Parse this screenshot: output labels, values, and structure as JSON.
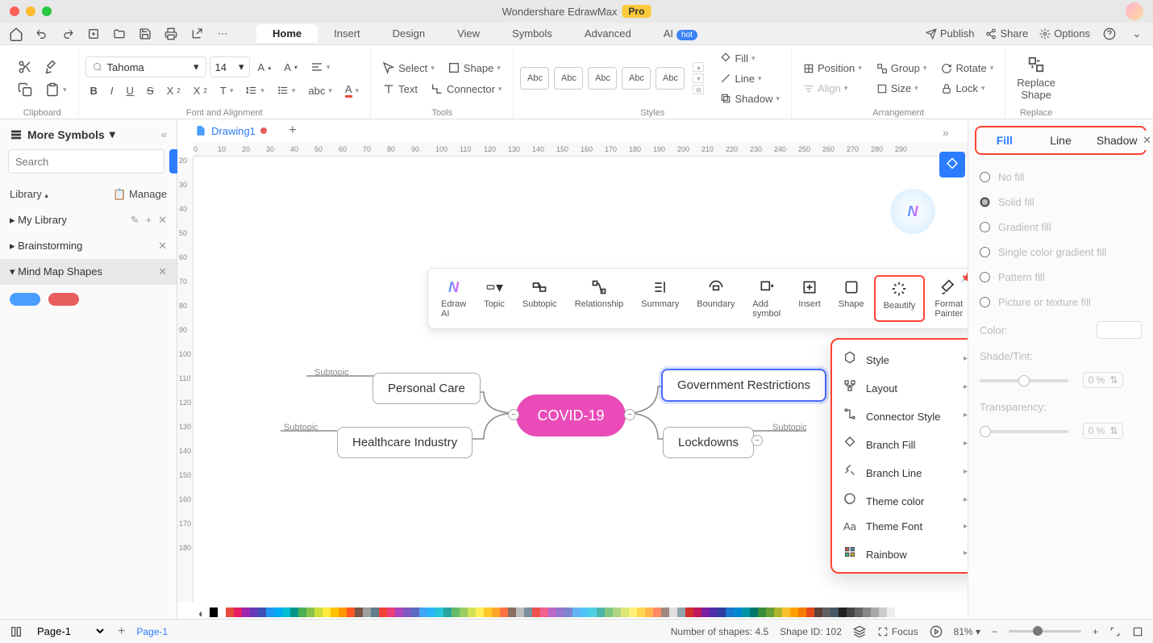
{
  "title": {
    "app": "Wondershare EdrawMax",
    "badge": "Pro"
  },
  "mainTabs": [
    "Home",
    "Insert",
    "Design",
    "View",
    "Symbols",
    "Advanced"
  ],
  "aiTab": {
    "label": "AI",
    "badge": "hot"
  },
  "toolbarActions": {
    "publish": "Publish",
    "share": "Share",
    "options": "Options"
  },
  "ribbon": {
    "clipboard": "Clipboard",
    "fontAlign": "Font and Alignment",
    "tools": "Tools",
    "styles": "Styles",
    "arrangement": "Arrangement",
    "replace": "Replace",
    "font": {
      "name": "Tahoma",
      "size": "14"
    },
    "select": "Select",
    "shape": "Shape",
    "text": "Text",
    "connector": "Connector",
    "styleSample": "Abc",
    "fill": "Fill",
    "line": "Line",
    "shadow": "Shadow",
    "position": "Position",
    "align": "Align",
    "group": "Group",
    "sizeBtn": "Size",
    "rotate": "Rotate",
    "lock": "Lock",
    "replaceShape": "Replace\nShape"
  },
  "leftPanel": {
    "title": "More Symbols",
    "searchPlaceholder": "Search",
    "searchBtn": "Search",
    "library": "Library",
    "manage": "Manage",
    "items": [
      "My Library",
      "Brainstorming",
      "Mind Map Shapes"
    ]
  },
  "doc": {
    "name": "Drawing1"
  },
  "rulerH": [
    "0",
    "10",
    "20",
    "30",
    "40",
    "50",
    "60",
    "70",
    "80",
    "90",
    "100",
    "110",
    "120",
    "130",
    "140",
    "150",
    "160",
    "170",
    "180",
    "190",
    "200",
    "210",
    "220",
    "230",
    "240",
    "250",
    "260",
    "270",
    "280",
    "290"
  ],
  "rulerV": [
    "20",
    "30",
    "40",
    "50",
    "60",
    "70",
    "80",
    "90",
    "100",
    "110",
    "120",
    "130",
    "140",
    "150",
    "160",
    "170",
    "180"
  ],
  "ctxToolbar": {
    "edrawAi": "Edraw AI",
    "topic": "Topic",
    "subtopic": "Subtopic",
    "relationship": "Relationship",
    "summary": "Summary",
    "boundary": "Boundary",
    "addSymbol": "Add symbol",
    "insert": "Insert",
    "shape": "Shape",
    "beautify": "Beautify",
    "formatPainter": "Format\nPainter"
  },
  "mindmap": {
    "center": "COVID-19",
    "nodes": {
      "personalCare": "Personal Care",
      "healthcare": "Healthcare Industry",
      "gov": "Government Restrictions",
      "lockdowns": "Lockdowns"
    },
    "subtopic": "Subtopic"
  },
  "dropdown": [
    "Style",
    "Layout",
    "Connector Style",
    "Branch Fill",
    "Branch Line",
    "Theme color",
    "Theme Font",
    "Rainbow"
  ],
  "rightPanel": {
    "tabs": [
      "Fill",
      "Line",
      "Shadow"
    ],
    "fills": [
      "No fill",
      "Solid fill",
      "Gradient fill",
      "Single color gradient fill",
      "Pattern fill",
      "Picture or texture fill"
    ],
    "colorLabel": "Color:",
    "shadeTint": "Shade/Tint:",
    "transparency": "Transparency:",
    "pct": "0 %"
  },
  "status": {
    "page1": "Page-1",
    "page1tab": "Page-1",
    "numShapes": "Number of shapes: 4.5",
    "shapeId": "Shape ID: 102",
    "focus": "Focus",
    "zoom": "81%"
  },
  "colors": [
    "#000",
    "#fff",
    "#e74c3c",
    "#e91e63",
    "#9c27b0",
    "#673ab7",
    "#3f51b5",
    "#2196f3",
    "#03a9f4",
    "#00bcd4",
    "#009688",
    "#4caf50",
    "#8bc34a",
    "#cddc39",
    "#ffeb3b",
    "#ffc107",
    "#ff9800",
    "#ff5722",
    "#795548",
    "#9e9e9e",
    "#607d8b",
    "#f44336",
    "#ec407a",
    "#ab47bc",
    "#7e57c2",
    "#5c6bc0",
    "#42a5f5",
    "#29b6f6",
    "#26c6da",
    "#26a69a",
    "#66bb6a",
    "#9ccc65",
    "#d4e157",
    "#ffee58",
    "#ffca28",
    "#ffa726",
    "#ff7043",
    "#8d6e63",
    "#bdbdbd",
    "#78909c",
    "#ef5350",
    "#f06292",
    "#ba68c8",
    "#9575cd",
    "#7986cb",
    "#64b5f6",
    "#4fc3f7",
    "#4dd0e1",
    "#4db6ac",
    "#81c784",
    "#aed581",
    "#dce775",
    "#fff176",
    "#ffd54f",
    "#ffb74d",
    "#ff8a65",
    "#a1887f",
    "#e0e0e0",
    "#90a4ae",
    "#d32f2f",
    "#c2185b",
    "#7b1fa2",
    "#512da8",
    "#303f9f",
    "#1976d2",
    "#0288d1",
    "#0097a7",
    "#00796b",
    "#388e3c",
    "#689f38",
    "#afb42b",
    "#fbc02d",
    "#ffa000",
    "#f57c00",
    "#e64a19",
    "#5d4037",
    "#616161",
    "#455a64",
    "#222",
    "#444",
    "#666",
    "#888",
    "#aaa",
    "#ccc",
    "#eee"
  ]
}
